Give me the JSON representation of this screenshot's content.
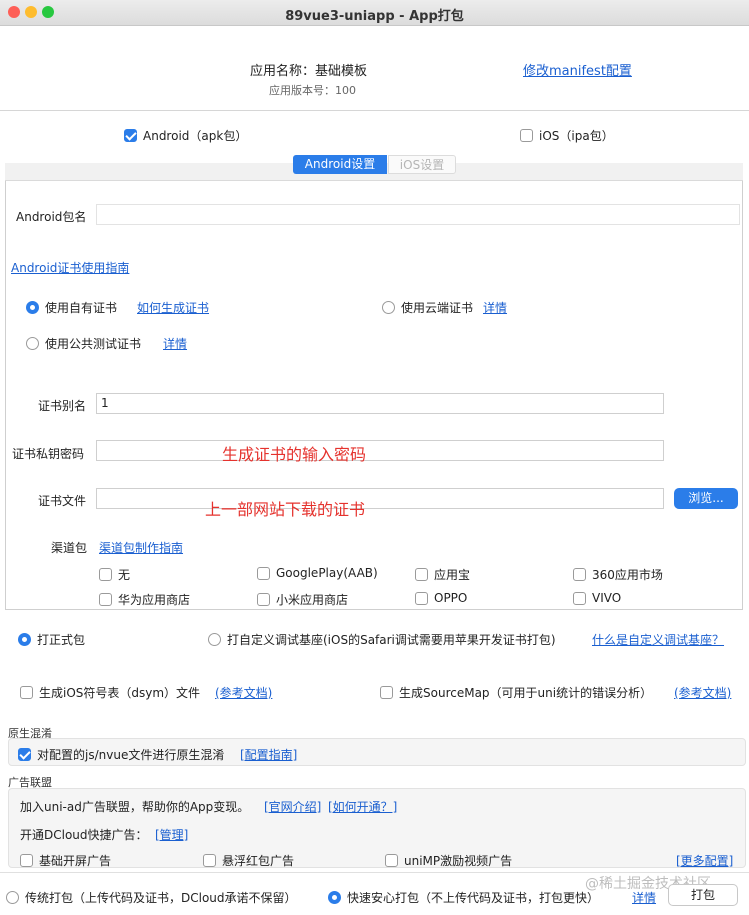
{
  "window": {
    "title": "89vue3-uniapp - App打包"
  },
  "header": {
    "app_name_label": "应用名称：基础模板",
    "app_version": "应用版本号：100",
    "manifest_link": "修改manifest配置"
  },
  "platforms": {
    "android": "Android（apk包）",
    "ios": "iOS（ipa包）"
  },
  "tabs": {
    "android": "Android设置",
    "ios": "iOS设置"
  },
  "android": {
    "package_label": "Android包名",
    "cert_guide": "Android证书使用指南",
    "own_cert": "使用自有证书",
    "how_to_cert": "如何生成证书",
    "cloud_cert": "使用云端证书",
    "cloud_detail": "详情",
    "public_cert": "使用公共测试证书",
    "public_detail": "详情",
    "alias_label": "证书别名",
    "alias_value": "1",
    "password_label": "证书私钥密码",
    "password_note": "生成证书的输入密码",
    "file_label": "证书文件",
    "file_note": "上一部网站下载的证书",
    "browse_btn": "浏览...",
    "channel_label": "渠道包",
    "channel_guide": "渠道包制作指南",
    "channels": [
      "无",
      "GooglePlay(AAB)",
      "应用宝",
      "360应用市场",
      "华为应用商店",
      "小米应用商店",
      "OPPO",
      "VIVO"
    ]
  },
  "build_type": {
    "release": "打正式包",
    "custom_base": "打自定义调试基座(iOS的Safari调试需要用苹果开发证书打包)",
    "custom_base_link": "什么是自定义调试基座？"
  },
  "symbols": {
    "ios_dsym": "生成iOS符号表（dsym）文件",
    "ios_dsym_doc": "(参考文档)",
    "sourcemap": "生成SourceMap（可用于uni统计的错误分析）",
    "sourcemap_doc": "(参考文档)"
  },
  "obfuscation": {
    "section": "原生混淆",
    "label": "对配置的js/nvue文件进行原生混淆",
    "guide": "[配置指南]"
  },
  "ads": {
    "section": "广告联盟",
    "join_text": "加入uni-ad广告联盟，帮助你的App变现。",
    "official": "[官网介绍]",
    "how_open": "[如何开通？]",
    "dcloud_quick": "开通DCloud快捷广告：",
    "manage": "[管理]",
    "items": [
      "基础开屏广告",
      "悬浮红包广告",
      "uniMP激励视频广告"
    ],
    "more": "[更多配置]"
  },
  "footer": {
    "traditional": "传统打包（上传代码及证书，DCloud承诺不保留）",
    "fast": "快速安心打包（不上传代码及证书，打包更快）",
    "detail": "详情",
    "pack_btn": "打包",
    "watermark": "@稀土掘金技术社区"
  }
}
